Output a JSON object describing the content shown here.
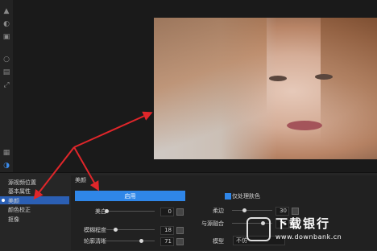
{
  "colors": {
    "accent": "#2f86e8",
    "arrow": "#e0262a",
    "active_item": "#2b5fb4"
  },
  "toolbar": {
    "icons": [
      "tool-icon-1",
      "tool-icon-2",
      "tool-icon-3",
      "tool-icon-4",
      "tool-icon-5",
      "tool-icon-6",
      "tool-icon-7",
      "tool-icon-8"
    ]
  },
  "sidebar": {
    "items": [
      {
        "label": "源视频位置"
      },
      {
        "label": "基本属性"
      },
      {
        "label": "美颜"
      },
      {
        "label": "颜色校正"
      },
      {
        "label": "抠像"
      }
    ],
    "active_index": 2
  },
  "panel": {
    "title": "美颜",
    "enable_label": "启用",
    "only_skin_label": "仅处理肤色",
    "only_skin_checked": true,
    "left": [
      {
        "label": "美白",
        "value": "0",
        "level": 0.0
      },
      {
        "label": "模糊程度",
        "value": "18",
        "level": 0.18
      },
      {
        "label": "轮廓清晰",
        "value": "71",
        "level": 0.71
      }
    ],
    "right": [
      {
        "label": "柔边",
        "value": "30",
        "level": 0.3
      },
      {
        "label": "与源融合",
        "value": "75",
        "level": 0.75
      }
    ],
    "mode_label": "模型",
    "mode_value": "不仿"
  },
  "watermark": {
    "text_cn": "下载银行",
    "url": "www.downbank.cn"
  }
}
